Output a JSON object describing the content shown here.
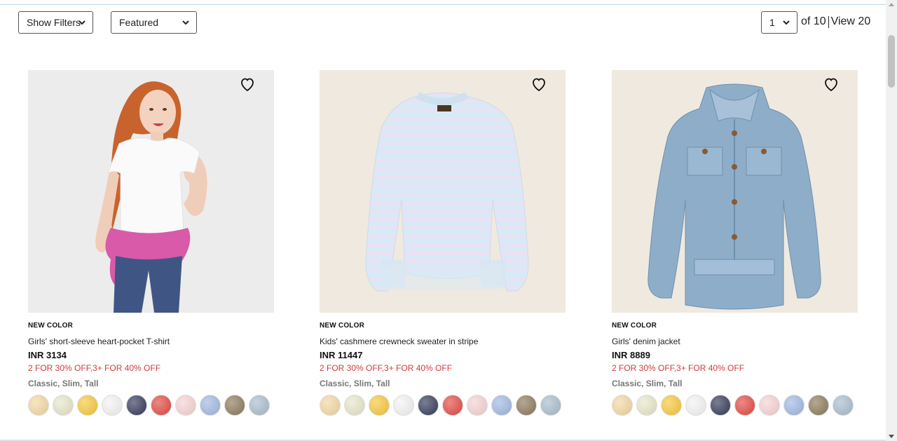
{
  "filters": {
    "show_filters_label": "Show Filters",
    "sort_label": "Featured"
  },
  "pagination": {
    "current_page": "1",
    "of_label": "of 10",
    "view_label": "View 20"
  },
  "products": [
    {
      "badge": "NEW COLOR",
      "name": "Girls' short-sleeve heart-pocket T-shirt",
      "price": "INR 3134",
      "promo": "2 FOR 30% OFF,3+ FOR 40% OFF",
      "fits": "Classic, Slim, Tall",
      "image_bg": "#ececec",
      "swatches": [
        "#f3d7a1",
        "#e6e6c9",
        "#f6c83a",
        "#f3f3f3",
        "#333a59",
        "#e24a42",
        "#f5d2d2",
        "#9fb8e0",
        "#8b7a5a",
        "#a9bccd"
      ]
    },
    {
      "badge": "NEW COLOR",
      "name": "Kids' cashmere crewneck sweater in stripe",
      "price": "INR 11447",
      "promo": "2 FOR 30% OFF,3+ FOR 40% OFF",
      "fits": "Classic, Slim, Tall",
      "image_bg": "#efe9df",
      "swatches": [
        "#f3d7a1",
        "#e6e6c9",
        "#f6c83a",
        "#f3f3f3",
        "#333a59",
        "#e24a42",
        "#f5d2d2",
        "#9fb8e0",
        "#8b7a5a",
        "#a9bccd"
      ]
    },
    {
      "badge": "NEW COLOR",
      "name": "Girls' denim jacket",
      "price": "INR 8889",
      "promo": "2 FOR 30% OFF,3+ FOR 40% OFF",
      "fits": "Classic, Slim, Tall",
      "image_bg": "#efe9df",
      "swatches": [
        "#f3d7a1",
        "#e6e6c9",
        "#f6c83a",
        "#f3f3f3",
        "#333a59",
        "#e24a42",
        "#f5d2d2",
        "#9fb8e0",
        "#8b7a5a",
        "#a9bccd"
      ]
    }
  ]
}
